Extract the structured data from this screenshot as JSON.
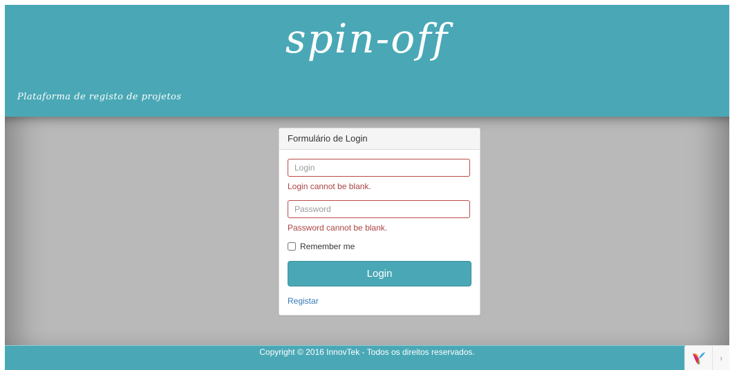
{
  "header": {
    "brand": "spin-off",
    "tagline": "Plataforma de registo de projetos"
  },
  "login_panel": {
    "title": "Formulário de Login",
    "login_field": {
      "placeholder": "Login",
      "value": "",
      "error": "Login cannot be blank."
    },
    "password_field": {
      "placeholder": "Password",
      "value": "",
      "error": "Password cannot be blank."
    },
    "remember_me": {
      "label": "Remember me",
      "checked": false
    },
    "submit_label": "Login",
    "register_link": "Registar"
  },
  "footer": {
    "copyright": "Copyright © 2016 InnovTek - Todos os direitos reservados."
  },
  "debug_toolbar": {
    "logo_icon": "yii-logo-icon",
    "toggle_icon": "chevron-right-icon",
    "toggle_glyph": "›"
  },
  "colors": {
    "brand": "#4aa8b6",
    "background": "#b9b9b9",
    "error": "#a94442",
    "link": "#337ab7"
  }
}
